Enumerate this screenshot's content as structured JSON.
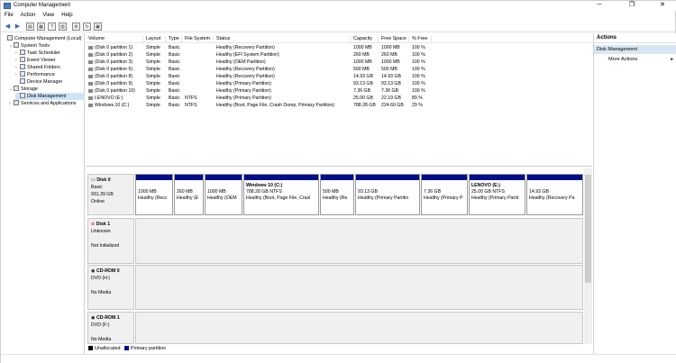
{
  "window": {
    "title": "Computer Management",
    "minimize": "─",
    "maximize": "❐",
    "close": "✕"
  },
  "menu": [
    "File",
    "Action",
    "View",
    "Help"
  ],
  "tree": [
    {
      "label": "Computer Management (Local)",
      "icon": "computer-icon",
      "indent": 0,
      "expander": ""
    },
    {
      "label": "System Tools",
      "icon": "tools-icon",
      "indent": 1,
      "expander": "⌄"
    },
    {
      "label": "Task Scheduler",
      "icon": "clock-icon",
      "indent": 2,
      "expander": "›"
    },
    {
      "label": "Event Viewer",
      "icon": "event-icon",
      "indent": 2,
      "expander": "›"
    },
    {
      "label": "Shared Folders",
      "icon": "folder-icon",
      "indent": 2,
      "expander": "›"
    },
    {
      "label": "Performance",
      "icon": "performance-icon",
      "indent": 2,
      "expander": "›"
    },
    {
      "label": "Device Manager",
      "icon": "device-icon",
      "indent": 2,
      "expander": ""
    },
    {
      "label": "Storage",
      "icon": "storage-icon",
      "indent": 1,
      "expander": "⌄"
    },
    {
      "label": "Disk Management",
      "icon": "disk-icon",
      "indent": 2,
      "expander": "",
      "selected": true
    },
    {
      "label": "Services and Applications",
      "icon": "services-icon",
      "indent": 1,
      "expander": "›"
    }
  ],
  "columns": [
    "Volume",
    "Layout",
    "Type",
    "File System",
    "Status",
    "Capacity",
    "Free Space",
    "% Free"
  ],
  "volumes": [
    [
      "(Disk 0 partition 1)",
      "Simple",
      "Basic",
      "",
      "Healthy (Recovery Partition)",
      "1000 MB",
      "1000 MB",
      "100 %"
    ],
    [
      "(Disk 0 partition 2)",
      "Simple",
      "Basic",
      "",
      "Healthy (EFI System Partition)",
      "260 MB",
      "260 MB",
      "100 %"
    ],
    [
      "(Disk 0 partition 3)",
      "Simple",
      "Basic",
      "",
      "Healthy (OEM Partition)",
      "1000 MB",
      "1000 MB",
      "100 %"
    ],
    [
      "(Disk 0 partition 6)",
      "Simple",
      "Basic",
      "",
      "Healthy (Recovery Partition)",
      "500 MB",
      "500 MB",
      "100 %"
    ],
    [
      "(Disk 0 partition 8)",
      "Simple",
      "Basic",
      "",
      "Healthy (Recovery Partition)",
      "14.93 GB",
      "14.93 GB",
      "100 %"
    ],
    [
      "(Disk 0 partition 9)",
      "Simple",
      "Basic",
      "",
      "Healthy (Primary Partition)",
      "93.13 GB",
      "93.13 GB",
      "100 %"
    ],
    [
      "(Disk 0 partition 10)",
      "Simple",
      "Basic",
      "",
      "Healthy (Primary Partition)",
      "7.36 GB",
      "7.36 GB",
      "100 %"
    ],
    [
      "LENOVO (E:)",
      "Simple",
      "Basic",
      "NTFS",
      "Healthy (Primary Partition)",
      "25.00 GB",
      "22.19 GB",
      "89 %"
    ],
    [
      "Windows 10 (C:)",
      "Simple",
      "Basic",
      "NTFS",
      "Healthy (Boot, Page File, Crash Dump, Primary Partition)",
      "788.28 GB",
      "224.60 GB",
      "29 %"
    ]
  ],
  "disks": [
    {
      "name": "Disk 0",
      "line1": "Basic",
      "line2": "931.39 GB",
      "line3": "Online"
    },
    {
      "name": "Disk 1",
      "line1": "Unknown",
      "line2": "",
      "line3": "Not Initialized"
    },
    {
      "name": "CD-ROM 0",
      "line1": "DVD (H:)",
      "line2": "",
      "line3": "No Media"
    },
    {
      "name": "CD-ROM 1",
      "line1": "DVD (F:)",
      "line2": "",
      "line3": "No Media"
    }
  ],
  "partitions": [
    {
      "title": "",
      "size": "1000 MB",
      "status": "Healthy (Recc"
    },
    {
      "title": "",
      "size": "260 MB",
      "status": "Healthy (E"
    },
    {
      "title": "",
      "size": "1000 MB",
      "status": "Healthy (OEM"
    },
    {
      "title": "Windows 10  (C:)",
      "size": "788.28 GB NTFS",
      "status": "Healthy (Boot, Page File, Crasl"
    },
    {
      "title": "",
      "size": "500 MB",
      "status": "Healthy (Re"
    },
    {
      "title": "",
      "size": "93.13 GB",
      "status": "Healthy (Primary Partitio"
    },
    {
      "title": "",
      "size": "7.36 GB",
      "status": "Healthy (Primary P"
    },
    {
      "title": "LENOVO  (E:)",
      "size": "25.00 GB NTFS",
      "status": "Healthy (Primary Partit"
    },
    {
      "title": "",
      "size": "14.93 GB",
      "status": "Healthy (Recovery Pa"
    }
  ],
  "legend": [
    {
      "label": "Unallocated",
      "color": "#000000"
    },
    {
      "label": "Primary partition",
      "color": "#000e8a"
    }
  ],
  "actions": {
    "header": "Actions",
    "section": "Disk Management",
    "more": "More Actions",
    "more_arrow": "▸"
  }
}
